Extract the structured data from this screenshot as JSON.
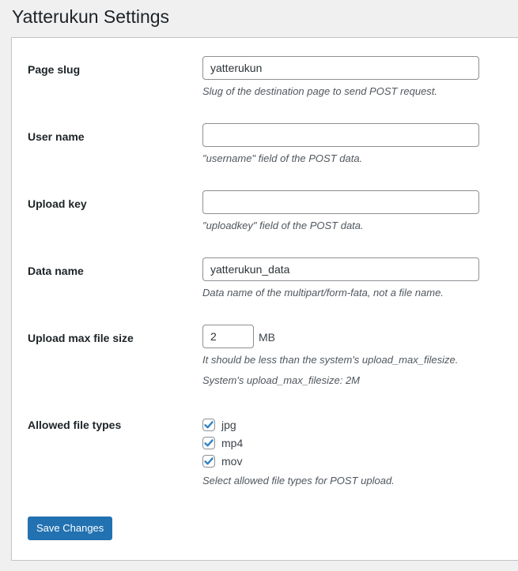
{
  "page": {
    "title": "Yatterukun Settings"
  },
  "fields": {
    "page_slug": {
      "label": "Page slug",
      "value": "yatterukun",
      "description": "Slug of the destination page to send POST request."
    },
    "user_name": {
      "label": "User name",
      "value": "",
      "description": "\"username\" field of the POST data."
    },
    "upload_key": {
      "label": "Upload key",
      "value": "",
      "description": "\"uploadkey\" field of the POST data."
    },
    "data_name": {
      "label": "Data name",
      "value": "yatterukun_data",
      "description": "Data name of the multipart/form-fata, not a file name."
    },
    "upload_max_file_size": {
      "label": "Upload max file size",
      "value": "2",
      "unit": "MB",
      "description": "It should be less than the system's upload_max_filesize.",
      "system_note": "System's upload_max_filesize: 2M"
    },
    "allowed_file_types": {
      "label": "Allowed file types",
      "options": [
        {
          "label": "jpg",
          "checked": true
        },
        {
          "label": "mp4",
          "checked": true
        },
        {
          "label": "mov",
          "checked": true
        }
      ],
      "description": "Select allowed file types for POST upload."
    }
  },
  "actions": {
    "save_label": "Save Changes"
  },
  "colors": {
    "accent": "#2271b1",
    "checkbox_check": "#3582c4"
  }
}
